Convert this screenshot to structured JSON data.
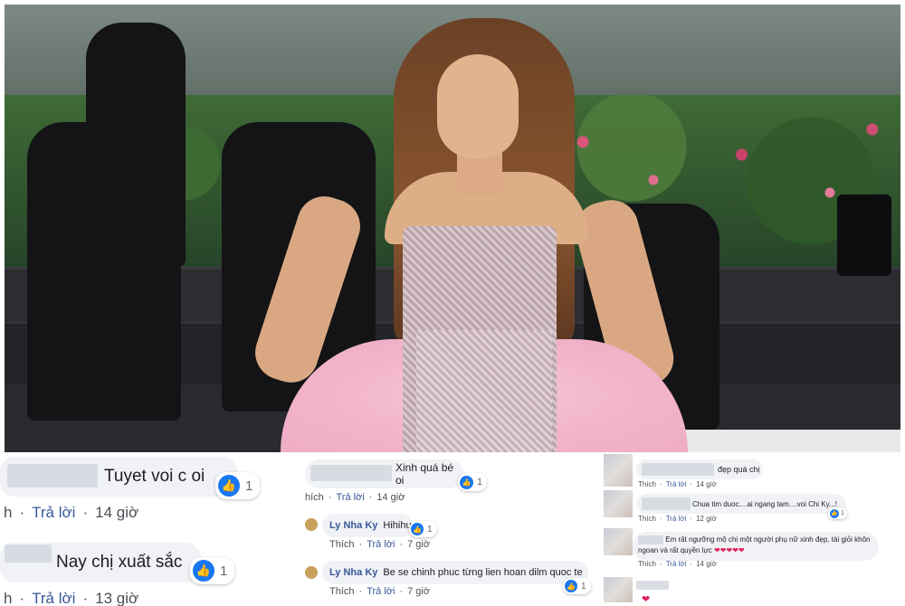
{
  "col1": {
    "comment1": {
      "text": "Tuyet voi c oi",
      "likes": "1",
      "meta_left": "h",
      "reply": "Trả lời",
      "time": "14 giờ"
    },
    "comment2": {
      "text": "Nay chị xuất sắc",
      "likes": "1",
      "meta_left": "h",
      "reply": "Trả lời",
      "time": "13 giờ"
    }
  },
  "col2": {
    "comment1": {
      "text": "Xinh quá bé oi",
      "likes": "1",
      "like_label": "hích",
      "reply": "Trả lời",
      "time": "14 giờ"
    },
    "reply1": {
      "name": "Ly Nha Ky",
      "text": "Hihihu",
      "likes": "1",
      "like_label": "Thích",
      "reply": "Trả lời",
      "time": "7 giờ"
    },
    "reply2": {
      "name": "Ly Nha Ky",
      "text": "Be se chinh phuc từng lien hoan dilm quoc te",
      "likes": "1",
      "like_label": "Thích",
      "reply": "Trả lời",
      "time": "7 giờ"
    }
  },
  "col3": {
    "comment1": {
      "text": "đẹp quá chị",
      "like_label": "Thích",
      "reply": "Trả lời",
      "time": "14 giờ"
    },
    "comment2": {
      "text": "Chua tim duoc....ai ngang tam....voi Chi Ky...!",
      "likes": "1",
      "like_label": "Thích",
      "reply": "Trả lời",
      "time": "12 giờ"
    },
    "comment3": {
      "text_line1": "Em rất ngưỡng mộ chị một người phụ nữ xinh đẹp, tài giỏi khôn",
      "text_line2": "ngoan và rất quyền lực",
      "hearts": "❤❤❤❤❤",
      "like_label": "Thích",
      "reply": "Trả lời",
      "time": "14 giờ"
    },
    "heart_reaction": "❤"
  },
  "separator": "·",
  "colors": {
    "like_blue": "#1877f2",
    "link_blue": "#385898",
    "bubble_gray": "#f0f2f5",
    "tulle_pink": "#f2b4cb"
  },
  "icons": {
    "like": "thumbs-up-icon",
    "heart": "heart-icon"
  }
}
